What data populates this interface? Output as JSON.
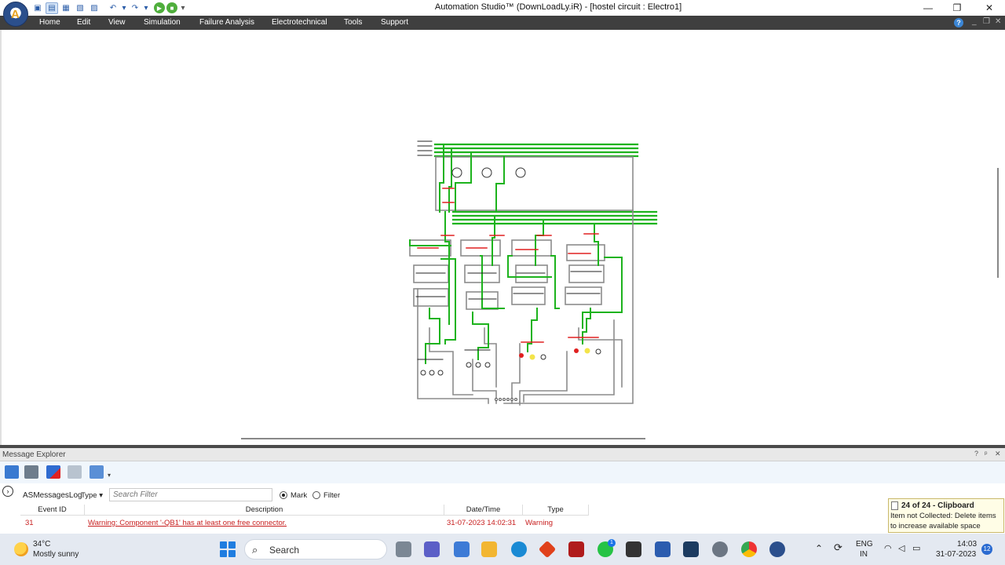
{
  "window": {
    "title": "Automation Studio™ (DownLoadLy.iR) - [hostel circuit : Electro1]",
    "minimize": "—",
    "maximize": "❐",
    "close": "✕"
  },
  "menu": {
    "items": [
      "Home",
      "Edit",
      "View",
      "Simulation",
      "Failure Analysis",
      "Electrotechnical",
      "Tools",
      "Support"
    ],
    "help_icon": "?"
  },
  "message_explorer": {
    "title": "Message Explorer",
    "controls": [
      "?",
      "ᵖ",
      "✕"
    ],
    "log_name": "ASMessagesLog",
    "type_dropdown": "Type ▾",
    "search_placeholder": "Search Filter",
    "radio_mark": "Mark",
    "radio_filter": "Filter",
    "selected_radio": "Mark",
    "columns": [
      "Event ID",
      "Description",
      "Date/Time",
      "Type"
    ],
    "rows": [
      {
        "event_id": "31",
        "description": "Warning: Component '-QB1' has at least one free connector.",
        "datetime": "31-07-2023 14:02:31",
        "type": "Warning"
      }
    ]
  },
  "clipboard_toast": {
    "title": "24 of 24 - Clipboard",
    "body": "Item not Collected: Delete items to increase available space"
  },
  "taskbar": {
    "temperature": "34°C",
    "weather": "Mostly sunny",
    "search_label": "Search",
    "language": "ENG",
    "region": "IN",
    "time": "14:03",
    "date": "31-07-2023",
    "notification_count": "12",
    "whatsapp_badge": "1"
  },
  "colors": {
    "menubar": "#3f3f3f",
    "wire_power": "#1db31d",
    "wire_control": "#8c8c8c",
    "component_active": "#e02020",
    "warning_text": "#c82020"
  }
}
